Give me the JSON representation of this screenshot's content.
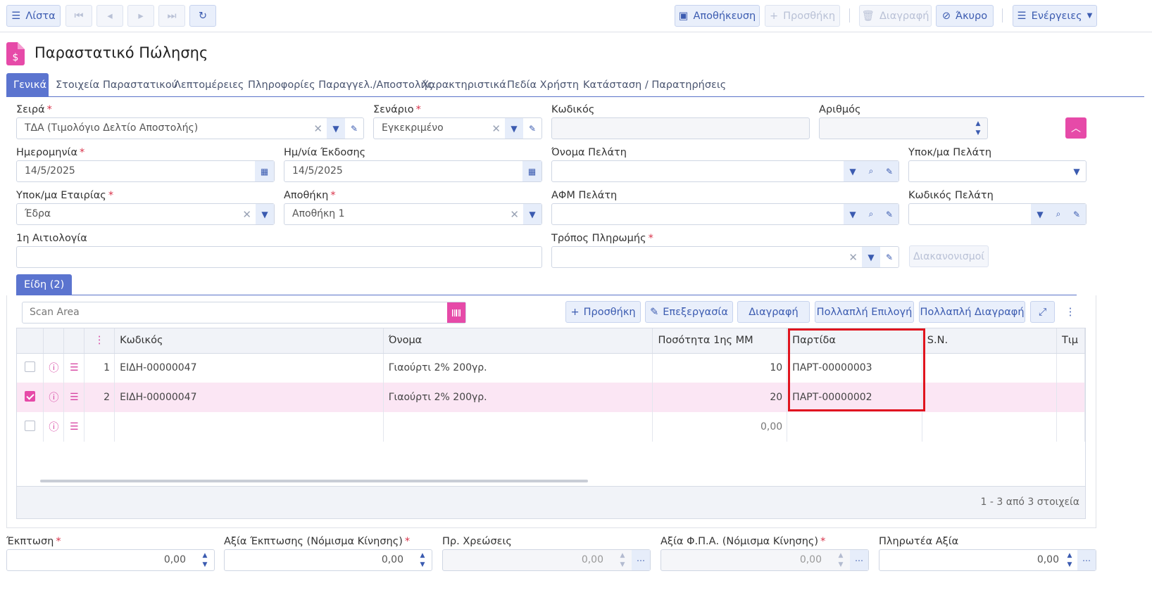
{
  "toolbar": {
    "list": "Λίστα",
    "save": "Αποθήκευση",
    "add": "Προσθήκη",
    "delete": "Διαγραφή",
    "cancel": "Άκυρο",
    "actions": "Ενέργειες"
  },
  "page": {
    "title": "Παραστατικό Πώλησης"
  },
  "tabs": [
    "Γενικά",
    "Στοιχεία Παραστατικού",
    "Λεπτομέρειες",
    "Πληροφορίες Παραγγελ./Αποστολής",
    "Χαρακτηριστικά",
    "Πεδία Χρήστη",
    "Κατάσταση / Παρατηρήσεις"
  ],
  "form": {
    "series": {
      "label": "Σειρά",
      "value": "ΤΔΑ (Τιμολόγιο Δελτίο Αποστολής)"
    },
    "scenario": {
      "label": "Σενάριο",
      "value": "Εγκεκριμένο"
    },
    "code": {
      "label": "Κωδικός",
      "value": ""
    },
    "number": {
      "label": "Αριθμός",
      "value": ""
    },
    "date": {
      "label": "Ημερομηνία",
      "value": "14/5/2025"
    },
    "issue_date": {
      "label": "Ημ/νία Έκδοσης",
      "value": "14/5/2025"
    },
    "customer_name": {
      "label": "Όνομα Πελάτη",
      "value": ""
    },
    "customer_branch": {
      "label": "Υποκ/μα Πελάτη",
      "value": ""
    },
    "company_branch": {
      "label": "Υποκ/μα Εταιρίας",
      "value": "Έδρα"
    },
    "warehouse": {
      "label": "Αποθήκη",
      "value": "Αποθήκη 1"
    },
    "customer_vat": {
      "label": "ΑΦΜ Πελάτη",
      "value": ""
    },
    "customer_code": {
      "label": "Κωδικός Πελάτη",
      "value": ""
    },
    "reason": {
      "label": "1η Αιτιολογία",
      "value": ""
    },
    "payment_method": {
      "label": "Τρόπος Πληρωμής",
      "value": ""
    },
    "settlements_button": "Διακανονισμοί"
  },
  "items": {
    "tab_label": "Είδη (2)",
    "scan_placeholder": "Scan Area",
    "buttons": {
      "add": "Προσθήκη",
      "edit": "Επεξεργασία",
      "delete": "Διαγραφή",
      "multi_select": "Πολλαπλή Επιλογή",
      "multi_delete": "Πολλαπλή Διαγραφή"
    },
    "columns": {
      "code": "Κωδικός",
      "name": "Όνομα",
      "qty": "Ποσότητα 1ης ΜΜ",
      "batch": "Παρτίδα",
      "sn": "S.N.",
      "price": "Τιμ"
    },
    "rows": [
      {
        "index": "1",
        "code": "ΕΙΔΗ-00000047",
        "name": "Γιαούρτι 2% 200γρ.",
        "qty": "10",
        "batch": "ΠΑΡΤ-00000003",
        "checked": false
      },
      {
        "index": "2",
        "code": "ΕΙΔΗ-00000047",
        "name": "Γιαούρτι 2% 200γρ.",
        "qty": "20",
        "batch": "ΠΑΡΤ-00000002",
        "checked": true
      },
      {
        "index": "",
        "code": "",
        "name": "",
        "qty": "0,00",
        "batch": "",
        "checked": false
      }
    ],
    "pager": "1 - 3 από 3 στοιχεία"
  },
  "totals": {
    "discount": {
      "label": "Έκπτωση",
      "value": "0,00"
    },
    "discount_value": {
      "label": "Αξία Έκπτωσης (Νόμισμα Κίνησης)",
      "value": "0,00"
    },
    "charges": {
      "label": "Πρ. Χρεώσεις",
      "value": "0,00"
    },
    "vat_value": {
      "label": "Αξία Φ.Π.Α. (Νόμισμα Κίνησης)",
      "value": "0,00"
    },
    "payable": {
      "label": "Πληρωτέα Αξία",
      "value": "0,00"
    }
  }
}
